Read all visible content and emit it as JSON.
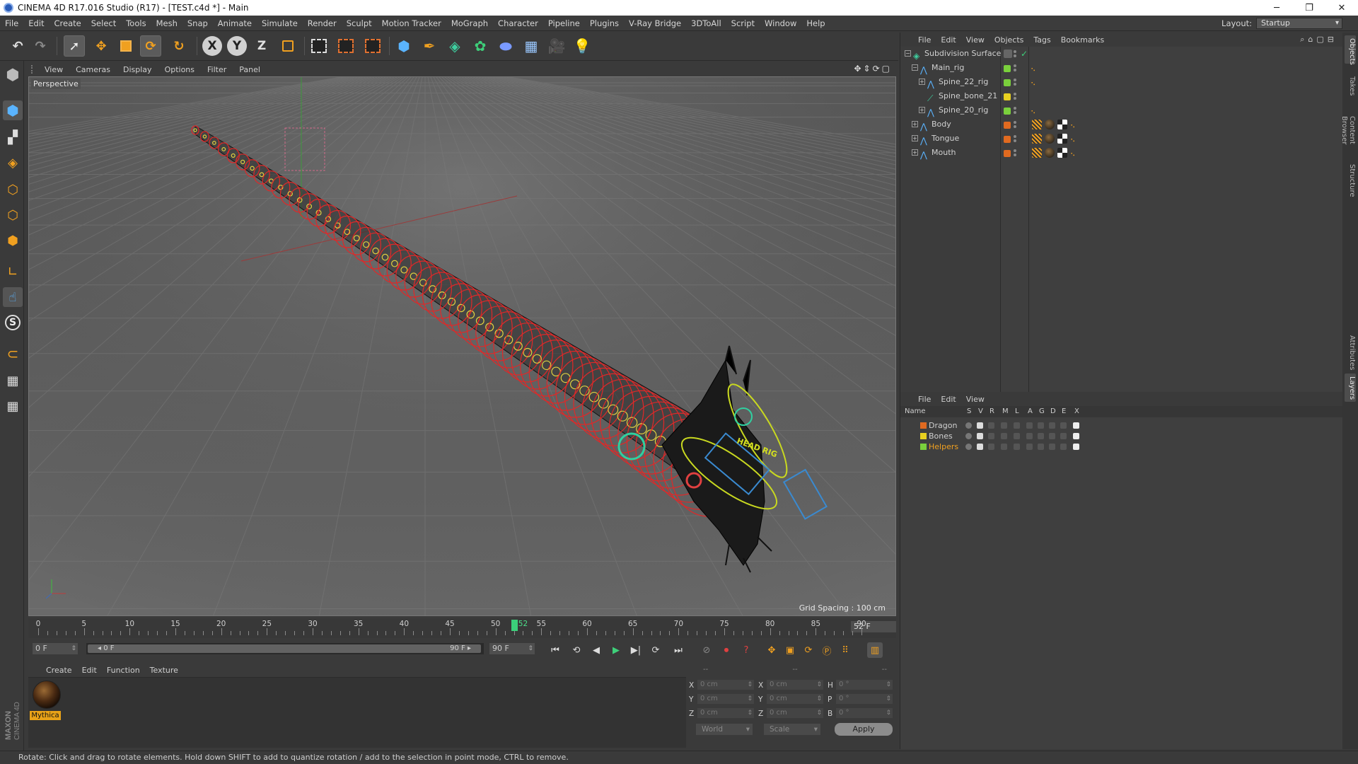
{
  "window": {
    "title": "CINEMA 4D R17.016 Studio (R17) - [TEST.c4d *] - Main",
    "minimize": "─",
    "restore": "❐",
    "close": "✕"
  },
  "menu": [
    "File",
    "Edit",
    "Create",
    "Select",
    "Tools",
    "Mesh",
    "Snap",
    "Animate",
    "Simulate",
    "Render",
    "Sculpt",
    "Motion Tracker",
    "MoGraph",
    "Character",
    "Pipeline",
    "Plugins",
    "V-Ray Bridge",
    "3DToAll",
    "Script",
    "Window",
    "Help"
  ],
  "layout": {
    "label": "Layout:",
    "value": "Startup"
  },
  "axis": {
    "x": "X",
    "y": "Y",
    "z": "Z"
  },
  "viewport": {
    "menu": [
      "View",
      "Cameras",
      "Display",
      "Options",
      "Filter",
      "Panel"
    ],
    "label": "Perspective",
    "grid_spacing": "Grid Spacing : 100 cm",
    "overlay_text": "HEAD RIG"
  },
  "timeline": {
    "ticks": [
      "0",
      "5",
      "10",
      "15",
      "20",
      "25",
      "30",
      "35",
      "40",
      "45",
      "50",
      "55",
      "60",
      "65",
      "70",
      "75",
      "80",
      "85",
      "90"
    ],
    "current": "52",
    "current_field": "52 F",
    "current_fraction": 0.578
  },
  "transport": {
    "start": "0 F",
    "range_start": "◂ 0 F",
    "range_end": "90 F ▸",
    "end": "90 F"
  },
  "material": {
    "menu": [
      "Create",
      "Edit",
      "Function",
      "Texture"
    ],
    "items": [
      {
        "name": "Mythica"
      }
    ]
  },
  "coords": {
    "header": [
      "--",
      "--",
      "--"
    ],
    "rows": [
      {
        "l1": "X",
        "v1": "0 cm",
        "l2": "X",
        "v2": "0 cm",
        "l3": "H",
        "v3": "0 °"
      },
      {
        "l1": "Y",
        "v1": "0 cm",
        "l2": "Y",
        "v2": "0 cm",
        "l3": "P",
        "v3": "0 °"
      },
      {
        "l1": "Z",
        "v1": "0 cm",
        "l2": "Z",
        "v2": "0 cm",
        "l3": "B",
        "v3": "0 °"
      }
    ],
    "mode1": "World",
    "mode2": "Scale",
    "apply": "Apply"
  },
  "status": "Rotate: Click and drag to rotate elements. Hold down SHIFT to add to quantize rotation / add to the selection in point mode, CTRL to remove.",
  "objects": {
    "menu": [
      "File",
      "Edit",
      "View",
      "Objects",
      "Tags",
      "Bookmarks"
    ],
    "rows": [
      {
        "name": "Subdivision Surface",
        "indent": 0,
        "exp": "−",
        "color": "",
        "tags": ""
      },
      {
        "name": "Main_rig",
        "indent": 1,
        "exp": "−",
        "color": "#7ad03c",
        "tags": "dots"
      },
      {
        "name": "Spine_22_rig",
        "indent": 2,
        "exp": "+",
        "color": "#7ad03c",
        "tags": "dots"
      },
      {
        "name": "Spine_bone_21",
        "indent": 2,
        "exp": "",
        "color": "#e8d020",
        "tags": ""
      },
      {
        "name": "Spine_20_rig",
        "indent": 2,
        "exp": "+",
        "color": "#7ad03c",
        "tags": "dots"
      },
      {
        "name": "Body",
        "indent": 1,
        "exp": "+",
        "color": "#e06a20",
        "tags": "mat"
      },
      {
        "name": "Tongue",
        "indent": 1,
        "exp": "+",
        "color": "#e06a20",
        "tags": "mat"
      },
      {
        "name": "Mouth",
        "indent": 1,
        "exp": "+",
        "color": "#e06a20",
        "tags": "mat"
      }
    ]
  },
  "layers": {
    "menu": [
      "File",
      "Edit",
      "View"
    ],
    "columns": [
      "Name",
      "S",
      "V",
      "R",
      "M",
      "L",
      "A",
      "G",
      "D",
      "E",
      "X"
    ],
    "rows": [
      {
        "name": "Dragon",
        "color": "#e06a20",
        "name_color": "#d0d0d0"
      },
      {
        "name": "Bones",
        "color": "#e8d020",
        "name_color": "#d0d0d0"
      },
      {
        "name": "Helpers",
        "color": "#7ad03c",
        "name_color": "#f0a020"
      }
    ]
  },
  "sidetabs": [
    "Objects",
    "Takes",
    "Content Browser",
    "Structure",
    "Attributes",
    "Layers"
  ],
  "brand": {
    "maxon": "MAXON",
    "c4d": "CINEMA 4D"
  }
}
